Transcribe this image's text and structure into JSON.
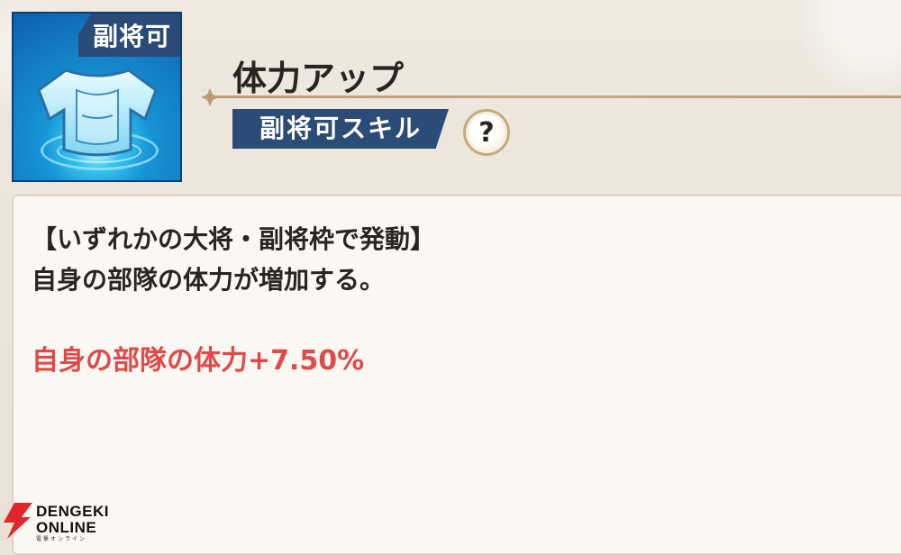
{
  "skill": {
    "icon": "armor-icon",
    "corner_tag": "副将可",
    "title": "体力アップ",
    "badge": "副将可スキル",
    "help_symbol": "?"
  },
  "description": {
    "line1": "【いずれかの大将・副将枠で発動】",
    "line2": "自身の部隊の体力が増加する。",
    "effect": "自身の部隊の体力+7.50%"
  },
  "watermark": {
    "line1": "DENGEKI",
    "line2": "ONLINE",
    "sub": "電撃オンライン"
  },
  "colors": {
    "accent_navy": "#2b4c76",
    "effect_red": "#e04a48",
    "panel_bg": "#fbf8f4"
  }
}
